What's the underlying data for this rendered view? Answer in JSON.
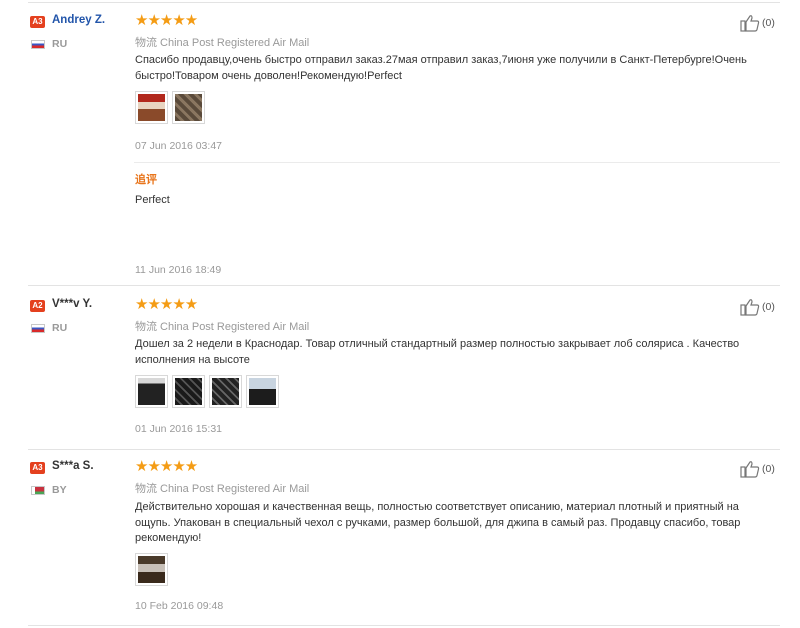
{
  "colors": {
    "star": "#f49c15",
    "badge": "#e4401e",
    "name_blue": "#2255aa",
    "followup": "#e8741a"
  },
  "reviews": [
    {
      "badge": "A3",
      "name": "Andrey Z.",
      "country": "RU",
      "flag": "ru",
      "rating_stars": "★★★★★",
      "rating": 5,
      "shipping": "物流 China Post Registered Air Mail",
      "text": "Спасибо продавцу,очень быстро отправил заказ.27мая отправил заказ,7июня уже получили в Санкт-Петербурге!Очень быстро!Товаром очень доволен!Рекомендую!Perfect",
      "photos": [
        "review-photo-1",
        "review-photo-2"
      ],
      "date": "07 Jun 2016 03:47",
      "followup": {
        "label": "追评",
        "text": "Perfect",
        "date": "11 Jun 2016 18:49"
      },
      "helpful_count": "(0)"
    },
    {
      "badge": "A2",
      "name": "V***v Y.",
      "country": "RU",
      "flag": "ru",
      "rating_stars": "★★★★★",
      "rating": 5,
      "shipping": "物流 China Post Registered Air Mail",
      "text": "Дошел за 2 недели в Краснодар. Товар отличный стандартный размер полностью закрывает лоб соляриса . Качество исполнения на высоте",
      "photos": [
        "review-photo-1",
        "review-photo-2",
        "review-photo-3",
        "review-photo-4"
      ],
      "date": "01 Jun 2016 15:31",
      "helpful_count": "(0)"
    },
    {
      "badge": "A3",
      "name": "S***a S.",
      "country": "BY",
      "flag": "by",
      "rating_stars": "★★★★★",
      "rating": 5,
      "shipping": "物流 China Post Registered Air Mail",
      "text": "Действительно хорошая и качественная вещь, полностью соответствует описанию, материал плотный и приятный на ощупь. Упакован в специальный чехол с ручками, размер большой, для джипа в самый раз. Продавцу спасибо, товар рекомендую!",
      "photos": [
        "review-photo-1"
      ],
      "date": "10 Feb 2016 09:48",
      "helpful_count": "(0)"
    }
  ]
}
